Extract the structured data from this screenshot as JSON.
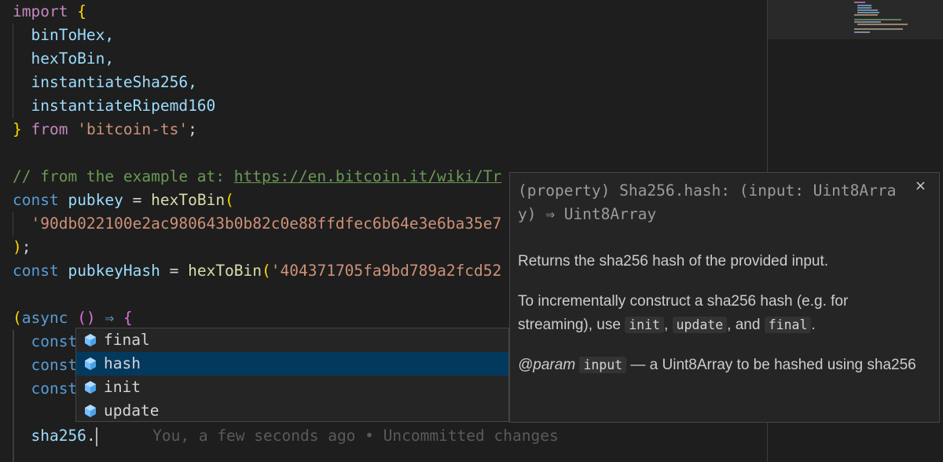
{
  "editor": {
    "lines": {
      "l1_import": "import",
      "l1_brace": "{",
      "l2": "binToHex,",
      "l3": "hexToBin,",
      "l4": "instantiateSha256,",
      "l5": "instantiateRipemd160",
      "l6_brace": "}",
      "l6_from": "from",
      "l6_str": "'bitcoin-ts'",
      "l6_semi": ";",
      "l8_comment": "// from the example at: ",
      "l8_link": "https://en.bitcoin.it/wiki/Tr",
      "l9_const": "const",
      "l9_name": "pubkey",
      "l9_eq": " = ",
      "l9_fn": "hexToBin",
      "l9_paren": "(",
      "l10_str": "'90db022100e2ac980643b0b82c0e88ffdfec6b64e3e6ba35e7",
      "l11": ");",
      "l12_const": "const",
      "l12_name": "pubkeyHash",
      "l12_eq": " = ",
      "l12_fn": "hexToBin",
      "l12_paren": "(",
      "l12_str": "'404371705fa9bd789a2fcd52",
      "l14_paren": "(",
      "l14_async": "async",
      "l14_parens": " () ",
      "l14_arrow": "⇒",
      "l14_brace": " {",
      "l15": "const",
      "l16": "const",
      "l17": "const",
      "l19_var": "sha256",
      "l19_dot": "."
    },
    "blame": "You, a few seconds ago • Uncommitted changes"
  },
  "suggest": {
    "items": [
      "final",
      "hash",
      "init",
      "update"
    ],
    "selected_index": 1,
    "icon": "method-cube-icon"
  },
  "details": {
    "signature": "(property) Sha256.hash: (input: Uint8Arra\ny) ⇒ Uint8Array",
    "close_label": "×",
    "p1": "Returns the sha256 hash of the provided input.",
    "p2_a": "To incrementally construct a sha256 hash (e.g. for streaming), use ",
    "p2_code1": "init",
    "p2_sep1": ", ",
    "p2_code2": "update",
    "p2_sep2": ", and ",
    "p2_code3": "final",
    "p2_end": ".",
    "p3_tag": "@param",
    "p3_code": "input",
    "p3_text": " — a Uint8Array to be hashed using sha256"
  },
  "colors": {
    "background": "#1e1e1e",
    "keyword": "#c586c0",
    "storage": "#569cd6",
    "function": "#dcdcaa",
    "variable": "#9cdcfe",
    "string": "#ce9178",
    "comment": "#6a9955",
    "selection": "#04395e"
  }
}
